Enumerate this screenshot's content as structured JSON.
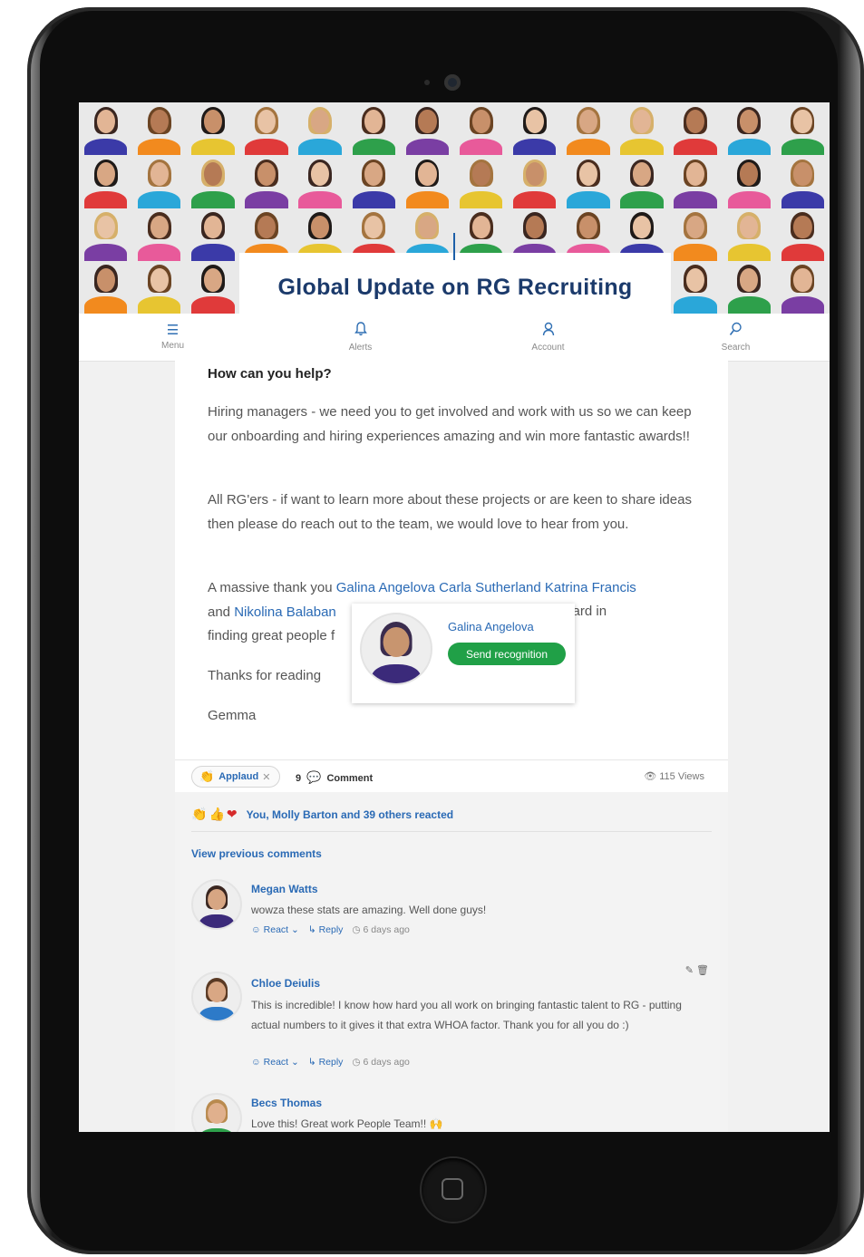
{
  "header": {
    "title": "Global Update on RG Recruiting"
  },
  "nav": [
    {
      "label": "Menu",
      "icon": "menu-icon",
      "glyph": "☰"
    },
    {
      "label": "Alerts",
      "icon": "bell-icon",
      "glyph": "🔔"
    },
    {
      "label": "Account",
      "icon": "user-icon",
      "glyph": "👤"
    },
    {
      "label": "Search",
      "icon": "search-icon",
      "glyph": "⚲"
    }
  ],
  "post": {
    "heading": "How can you help?",
    "para1": "Hiring managers - we need you to get involved and work with us so we can keep our onboarding and hiring experiences amazing and win more fantastic awards!!",
    "para2": "All RG'ers - if want to learn more about these projects or are keen to share ideas then please do reach out to the team, we would love to hear from you.",
    "thanks_prefix": "A massive thank you",
    "mentions": [
      "Galina Angelova",
      "Carla Sutherland",
      "Katrina Francis",
      "Nikolina Balaban"
    ],
    "and": "and",
    "thanks_suffix_right": "ing hard in",
    "thanks_line3": "finding great people f",
    "closing": "Thanks for reading",
    "signature": "Gemma"
  },
  "hover_card": {
    "name": "Galina Angelova",
    "button": "Send recognition"
  },
  "actions": {
    "applaud": "Applaud",
    "comment_count": "9",
    "comment_label": "Comment",
    "views": "115 Views"
  },
  "reactions": {
    "emojis": [
      "👏",
      "👍",
      "❤"
    ],
    "text": "You, Molly Barton and 39 others reacted"
  },
  "comments": {
    "view_previous": "View previous comments",
    "items": [
      {
        "name": "Megan Watts",
        "text": "wowza these stats are amazing. Well done guys!",
        "react": "React",
        "reply": "Reply",
        "time": "6 days ago"
      },
      {
        "name": "Chloe Deiulis",
        "text": "This is incredible! I know how hard you all work on bringing fantastic talent to RG - putting actual numbers to it gives it that extra WHOA factor. Thank you for all you do :)",
        "react": "React",
        "reply": "Reply",
        "time": "6 days ago"
      },
      {
        "name": "Becs Thomas",
        "text": "Love this! Great work People Team!! 🙌"
      }
    ]
  },
  "colors": {
    "brand_navy": "#1b3a6b",
    "link_blue": "#2a6ab5",
    "recognition_green": "#20a047"
  }
}
